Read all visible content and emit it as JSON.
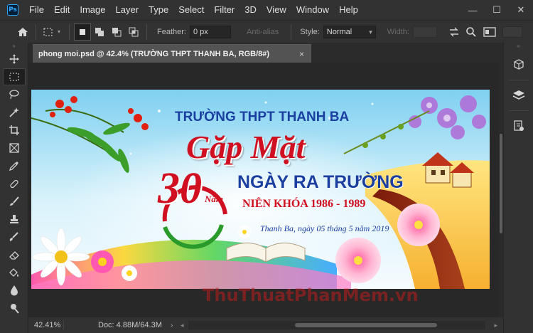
{
  "app": {
    "logo_text": "Ps"
  },
  "menu": [
    "File",
    "Edit",
    "Image",
    "Layer",
    "Type",
    "Select",
    "Filter",
    "3D",
    "View",
    "Window",
    "Help"
  ],
  "window_controls": {
    "minimize": "—",
    "maximize": "☐",
    "close": "✕"
  },
  "options": {
    "feather_label": "Feather:",
    "feather_value": "0 px",
    "anti_alias_label": "Anti-alias",
    "style_label": "Style:",
    "style_value": "Normal",
    "width_label": "Width:"
  },
  "document": {
    "tab_title": "phong moi.psd @ 42.4% (TRƯỜNG THPT THANH BA, RGB/8#)",
    "tab_close": "×"
  },
  "status": {
    "zoom": "42.41%",
    "doc_info": "Doc: 4.88M/64.3M",
    "arrow": "›"
  },
  "banner": {
    "school": "TRƯỜNG THPT THANH BA",
    "title": "Gặp Mặt",
    "number": "30",
    "nam": "Năm",
    "subtitle": "NGÀY RA TRƯỜNG",
    "years": "NIÊN KHÓA 1986 - 1989",
    "date_line": "Thanh Ba, ngày 05 tháng 5 năm 2019"
  },
  "watermark": "ThuThuatPhanMem.vn",
  "colors": {
    "menubar": "#323232",
    "workspace": "#535353",
    "canvas_bg": "#282828",
    "banner_blue": "#1a3fa0",
    "banner_red": "#d01020"
  }
}
